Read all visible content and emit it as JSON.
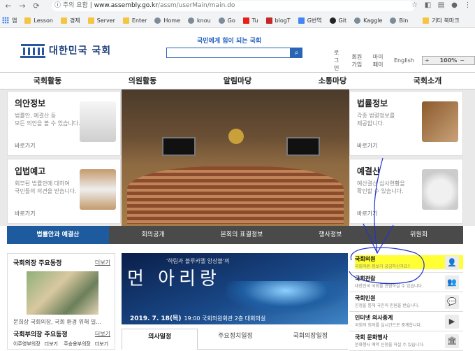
{
  "browser": {
    "security_warning": "주의 요함",
    "url_host": "www.assembly.go.kr",
    "url_path": "/assm/userMain/main.do",
    "bookmarks": [
      {
        "label": "앱",
        "icon": "apps-icon"
      },
      {
        "label": "Lesson",
        "icon": "folder-icon"
      },
      {
        "label": "경제",
        "icon": "folder-icon"
      },
      {
        "label": "Server",
        "icon": "folder-icon"
      },
      {
        "label": "Enter",
        "icon": "folder-icon"
      },
      {
        "label": "Home",
        "icon": "globe-icon"
      },
      {
        "label": "knou",
        "icon": "globe-icon"
      },
      {
        "label": "Go",
        "icon": "globe-icon"
      },
      {
        "label": "Tu",
        "icon": "youtube-icon"
      },
      {
        "label": "blogT",
        "icon": "red-icon"
      },
      {
        "label": "G번역",
        "icon": "translate-icon"
      },
      {
        "label": "Git",
        "icon": "github-icon"
      },
      {
        "label": "Kaggle",
        "icon": "globe-icon"
      },
      {
        "label": "Bin",
        "icon": "globe-icon"
      },
      {
        "label": "기타 북마크",
        "icon": "folder-icon"
      }
    ]
  },
  "header": {
    "logo_text": "대한민국 국회",
    "slogan": "국민에게 힘이 되는 국회",
    "search_placeholder": "",
    "util_links": [
      "로그인",
      "회원가입",
      "마이페이",
      "English"
    ],
    "zoom_value": "100%"
  },
  "gnb": [
    "국회활동",
    "의원활동",
    "알림마당",
    "소통마당",
    "국회소개"
  ],
  "hero_cards": [
    {
      "title": "의안정보",
      "desc1": "법률안, 예결산 등",
      "desc2": "모든 의안을 볼 수 있습니다.",
      "link": "바로가기"
    },
    {
      "title": "입법예고",
      "desc1": "회부된 법률안에 대하여",
      "desc2": "국민들의 의견을 받습니다.",
      "link": "바로가기"
    },
    {
      "title": "법률정보",
      "desc1": "각종 법령정보를",
      "desc2": "제공합니다.",
      "link": "바로가기"
    },
    {
      "title": "예결산",
      "desc1": "예산결산 심사현황을",
      "desc2": "확인할 수 있습니다.",
      "link": "바로가기"
    }
  ],
  "tabs": [
    "법률안과 예결산",
    "회의공개",
    "본회의 표결정보",
    "행사정보",
    "위원회"
  ],
  "news": {
    "title": "국회의장 주요동정",
    "more": "더보기",
    "caption": "문희상 국회의장, 국회 환경 위해 일...",
    "deputy_title": "국회부의장 주요동정",
    "deputy_more": "더보기",
    "deputies": [
      "이주영부의장",
      "주승용부의장"
    ],
    "deputy_more_small": [
      "더보기",
      "더보기"
    ]
  },
  "banner": {
    "top_text": "'하림과 블루카멜 앙상블'의",
    "big_text": "먼 아리랑",
    "date": "2019. 7. 18(목)",
    "time_place": "19:00  국회의원회관 2층 대회의실"
  },
  "banner_tabs": [
    "의사일정",
    "주요정치일정",
    "국회의장일정"
  ],
  "quick_links": [
    {
      "title": "국회의원",
      "desc": "국회의원 정보가 궁금하신가요?",
      "icon": "person-icon",
      "glyph": "👤"
    },
    {
      "title": "국회관람",
      "desc": "대한민국 국회를 관람하실 수 있습니다.",
      "icon": "group-icon",
      "glyph": "👥"
    },
    {
      "title": "국회민원",
      "desc": "진정을 통해 국민의 민원을 받습니다.",
      "icon": "chat-icon",
      "glyph": "💬"
    },
    {
      "title": "인터넷 의사중계",
      "desc": "국회의 회의를 실시간으로 중계합니다.",
      "icon": "play-icon",
      "glyph": "▶"
    },
    {
      "title": "국회 문화행사",
      "desc": "문화행사 예약 신청을 하실 수 있습니다.",
      "icon": "building-icon",
      "glyph": "🏛"
    }
  ],
  "colors": {
    "brand_blue": "#1e5b9e",
    "highlight": "#ffff33",
    "annotation": "#2233cc"
  }
}
